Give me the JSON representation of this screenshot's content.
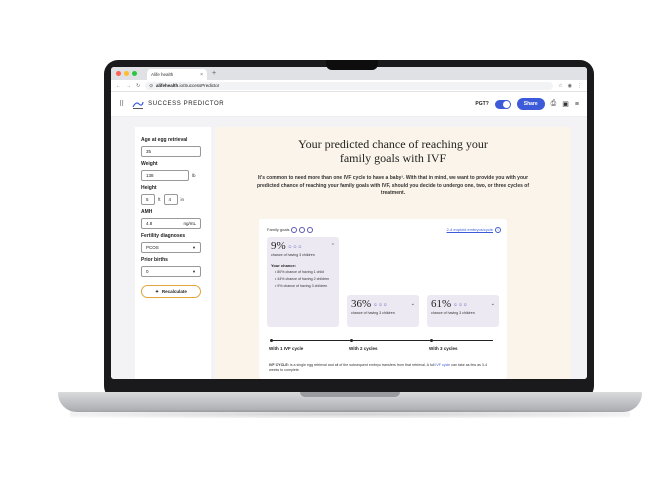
{
  "browser": {
    "tab_title": "Alife health",
    "tab_close": "×",
    "newtab": "+",
    "url_prefix": "alifehealth",
    "url_rest": ".io/SuccessPredictor"
  },
  "header": {
    "brand": "SUCCESS PREDICTOR",
    "pgt_label": "PGT?",
    "share_label": "Share"
  },
  "sidebar": {
    "age_label": "Age at egg retrieval",
    "age_value": "35",
    "weight_label": "Weight",
    "weight_value": "138",
    "weight_unit": "lb",
    "height_label": "Height",
    "height_ft": "5",
    "height_ft_unit": "ft",
    "height_in": "4",
    "height_in_unit": "in",
    "amh_label": "AMH",
    "amh_value": "4.8",
    "amh_unit": "ng/mL",
    "fertility_label": "Fertility diagnoses",
    "fertility_value": "PCOS",
    "births_label": "Prior births",
    "births_value": "0",
    "recalc_label": "Recalculate"
  },
  "main": {
    "headline": "Your predicted chance of reaching your family goals with IVF",
    "intro": "It's common to need more than one IVF cycle to have a baby¹. With that in mind, we want to provide you with your predicted chance of reaching your family goals with IVF, should you decide to undergo one, two, or three cycles of treatment."
  },
  "card": {
    "family_goals": "Family goals",
    "explain_link": "2-4 euploid embryos/cycle",
    "c1_pct": "9%",
    "c1_sub": "chance of having 3 children",
    "your_chance": "Your chance:",
    "bullets": [
      "• 80% chance of having 1 child",
      "• 44% chance of having 2 children",
      "• 9% chance of having 3 children"
    ],
    "c2_pct": "36%",
    "c2_sub": "chance of having 3 children",
    "c3_pct": "61%",
    "c3_sub": "chance of having 3 children",
    "t1": "With 1 IVF cycle",
    "t2": "With 2 cycles",
    "t3": "With 3 cycles",
    "fn_bold": "IVF CYCLE:",
    "fn_text": " is a single egg retrieval and all of the subsequent embryo transfers from that retrieval. A full ",
    "fn_link": "IVF cycle",
    "fn_text2": " can take as few as 3-4 weeks to complete."
  },
  "colors": {
    "accent": "#3d5bd9",
    "faces": "#5b57b8",
    "recalc_border": "#e3a53c",
    "main_bg": "#fbf4ea"
  }
}
